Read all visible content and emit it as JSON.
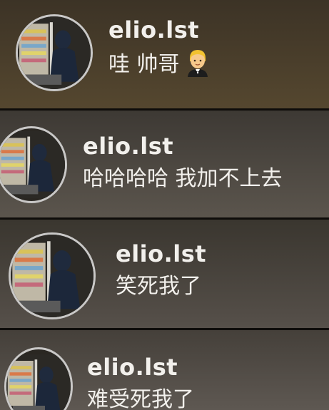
{
  "comments": [
    {
      "username": "elio.lst",
      "text": "哇 帅哥",
      "emoji": "man-in-tuxedo-icon",
      "bg_top": "#3c3326",
      "bg_bottom": "#50432f"
    },
    {
      "username": "elio.lst",
      "text": "哈哈哈哈 我加不上去",
      "bg_top": "#45403a",
      "bg_bottom": "#5a544c"
    },
    {
      "username": "elio.lst",
      "text": "笑死我了",
      "bg_top": "#3f3a33",
      "bg_bottom": "#56504a"
    },
    {
      "username": "elio.lst",
      "text": "难受死我了",
      "bg_top": "#4a453f",
      "bg_bottom": "#5c5650"
    }
  ],
  "colors": {
    "text": "#f2f0ec",
    "avatar_ring": "#d9d6d0"
  }
}
